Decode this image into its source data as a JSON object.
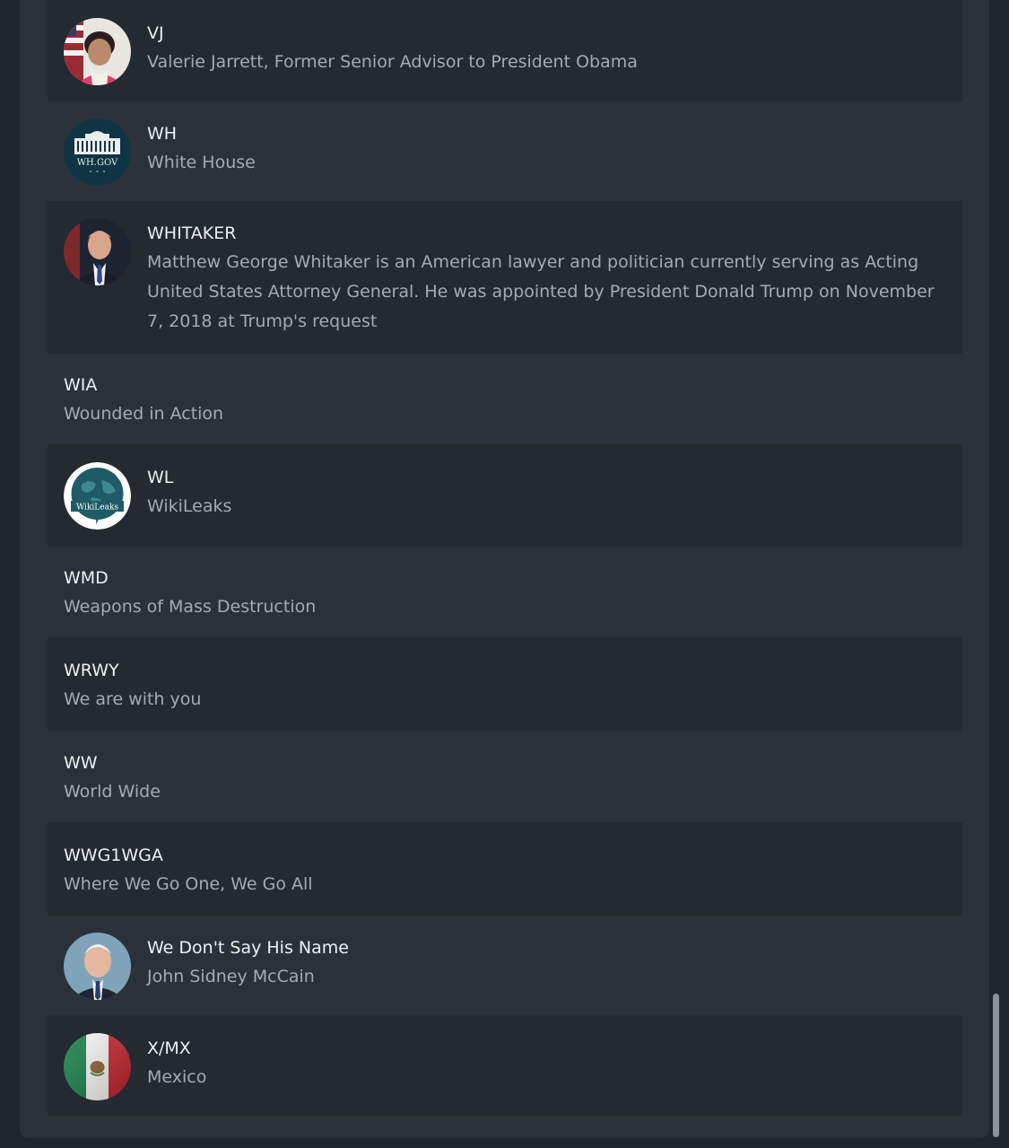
{
  "glossary": {
    "entries": [
      {
        "term": "VJ",
        "description": "Valerie Jarrett, Former Senior Advisor to President Obama",
        "icon": "portrait-valerie-jarrett"
      },
      {
        "term": "WH",
        "description": "White House",
        "icon": "wh-gov-logo",
        "logo_text": "WH.GOV"
      },
      {
        "term": "WHITAKER",
        "description": "Matthew George Whitaker is an American lawyer and politician currently serving as Acting United States Attorney General. He was appointed by President Donald Trump on November 7, 2018 at Trump's request",
        "icon": "portrait-whitaker"
      },
      {
        "term": "WIA",
        "description": "Wounded in Action"
      },
      {
        "term": "WL",
        "description": "WikiLeaks",
        "icon": "wikileaks-logo",
        "logo_text": "WikiLeaks"
      },
      {
        "term": "WMD",
        "description": "Weapons of Mass Destruction"
      },
      {
        "term": "WRWY",
        "description": "We are with you"
      },
      {
        "term": "WW",
        "description": "World Wide"
      },
      {
        "term": "WWG1WGA",
        "description": "Where We Go One, We Go All"
      },
      {
        "term": "We Don't Say His Name",
        "description": "John Sidney McCain",
        "icon": "portrait-mccain"
      },
      {
        "term": "X/MX",
        "description": "Mexico",
        "icon": "mexico-flag"
      }
    ]
  },
  "colors": {
    "background": "#20242b",
    "panel": "#2b313a",
    "row_dark": "#252930",
    "term_text": "#eef0f2",
    "description_text": "#a4abb4"
  }
}
